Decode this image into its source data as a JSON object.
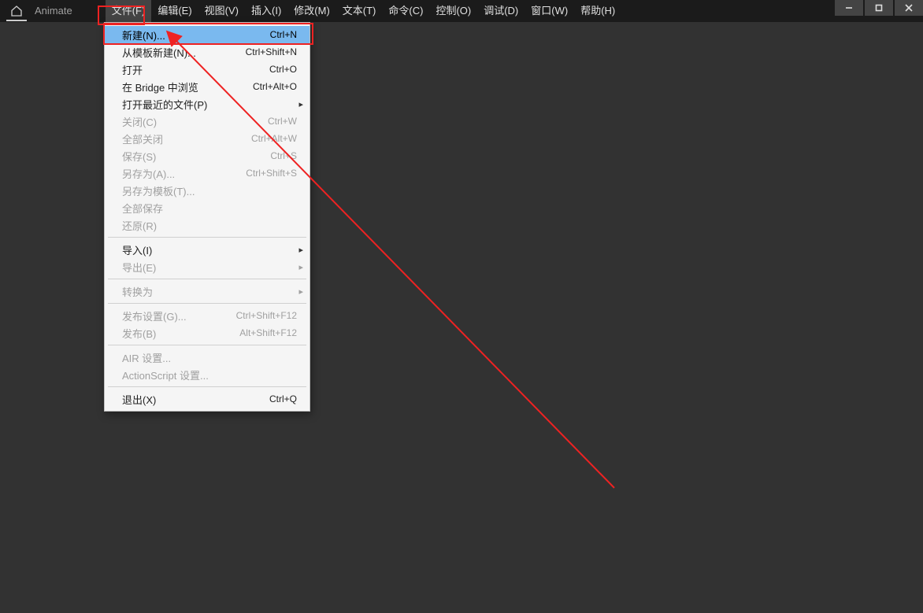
{
  "app": {
    "title": "Animate"
  },
  "menubar": [
    {
      "label": "文件(F)",
      "open": true
    },
    {
      "label": "编辑(E)"
    },
    {
      "label": "视图(V)"
    },
    {
      "label": "插入(I)"
    },
    {
      "label": "修改(M)"
    },
    {
      "label": "文本(T)"
    },
    {
      "label": "命令(C)"
    },
    {
      "label": "控制(O)"
    },
    {
      "label": "调试(D)"
    },
    {
      "label": "窗口(W)"
    },
    {
      "label": "帮助(H)"
    }
  ],
  "dropdown": {
    "groups": [
      [
        {
          "label": "新建(N)...",
          "shortcut": "Ctrl+N",
          "highlight": true
        },
        {
          "label": "从模板新建(N)...",
          "shortcut": "Ctrl+Shift+N"
        },
        {
          "label": "打开",
          "shortcut": "Ctrl+O"
        },
        {
          "label": "在 Bridge 中浏览",
          "shortcut": "Ctrl+Alt+O"
        },
        {
          "label": "打开最近的文件(P)",
          "submenu": true
        },
        {
          "label": "关闭(C)",
          "shortcut": "Ctrl+W",
          "disabled": true
        },
        {
          "label": "全部关闭",
          "shortcut": "Ctrl+Alt+W",
          "disabled": true
        },
        {
          "label": "保存(S)",
          "shortcut": "Ctrl+S",
          "disabled": true
        },
        {
          "label": "另存为(A)...",
          "shortcut": "Ctrl+Shift+S",
          "disabled": true
        },
        {
          "label": "另存为模板(T)...",
          "disabled": true
        },
        {
          "label": "全部保存",
          "disabled": true
        },
        {
          "label": "还原(R)",
          "disabled": true
        }
      ],
      [
        {
          "label": "导入(I)",
          "submenu": true
        },
        {
          "label": "导出(E)",
          "submenu": true,
          "disabled": true
        }
      ],
      [
        {
          "label": "转换为",
          "submenu": true,
          "disabled": true
        }
      ],
      [
        {
          "label": "发布设置(G)...",
          "shortcut": "Ctrl+Shift+F12",
          "disabled": true
        },
        {
          "label": "发布(B)",
          "shortcut": "Alt+Shift+F12",
          "disabled": true
        }
      ],
      [
        {
          "label": "AIR 设置...",
          "disabled": true
        },
        {
          "label": "ActionScript 设置...",
          "disabled": true
        }
      ],
      [
        {
          "label": "退出(X)",
          "shortcut": "Ctrl+Q"
        }
      ]
    ]
  }
}
